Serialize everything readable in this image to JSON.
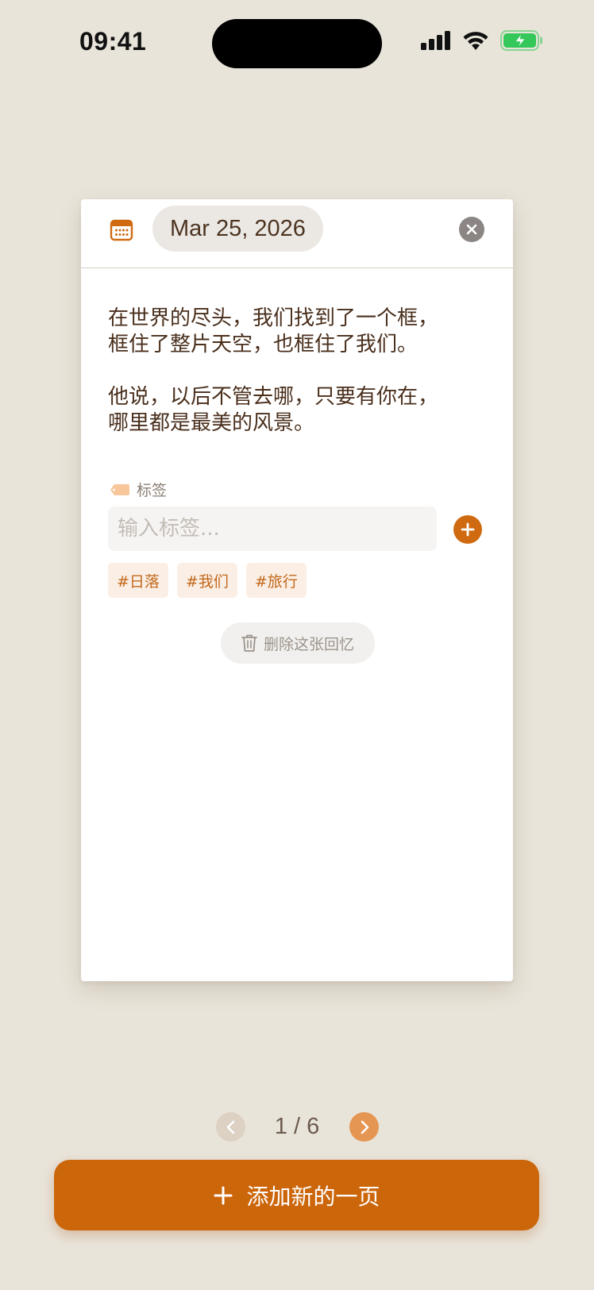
{
  "status_bar": {
    "time": "09:41"
  },
  "card": {
    "date": "Mar 25, 2026",
    "text": "在世界的尽头，我们找到了一个框，\n框住了整片天空，也框住了我们。\n\n他说，以后不管去哪，只要有你在，\n哪里都是最美的风景。",
    "tags_label": "标签",
    "tag_input_placeholder": "输入标签...",
    "tag_input_value": "",
    "tags": [
      "#日落",
      "#我们",
      "#旅行"
    ],
    "delete_label": "删除这张回忆"
  },
  "pagination": {
    "current": 1,
    "total": 6,
    "display": "1 / 6"
  },
  "add_page_label": "添加新的一页",
  "colors": {
    "background": "#e9e4da",
    "accent": "#cc660b",
    "tag_bg": "#fbeee4",
    "tag_text": "#c2691d",
    "battery": "#34c759"
  },
  "icons": {
    "calendar": "calendar-icon",
    "close": "close-icon",
    "tag": "tag-icon",
    "add": "plus-icon",
    "delete": "trash-icon",
    "prev": "chevron-left-icon",
    "next": "chevron-right-icon"
  }
}
